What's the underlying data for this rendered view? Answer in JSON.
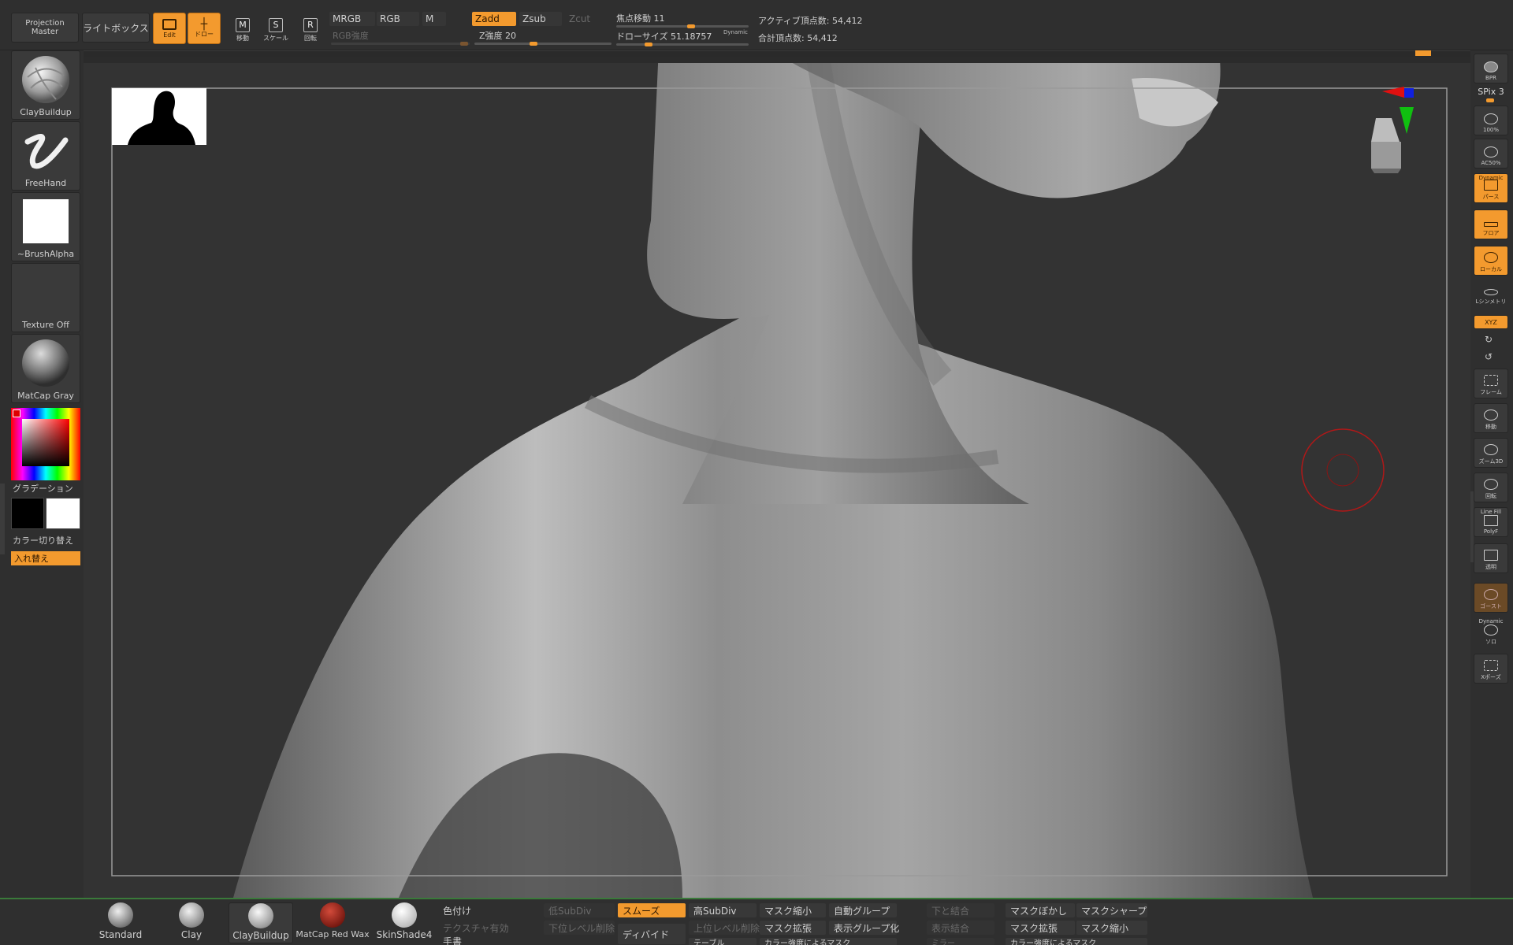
{
  "toolbar": {
    "projection_master": "Projection Master",
    "lightbox": "ライトボックス",
    "edit": "Edit",
    "draw": "ドロー",
    "move": "移動",
    "scale": "スケール",
    "rotate": "回転",
    "mrgb": "MRGB",
    "rgb": "RGB",
    "m": "M",
    "rgb_intensity": "RGB強度",
    "zadd": "Zadd",
    "zsub": "Zsub",
    "zcut": "Zcut",
    "z_intensity": "Z強度 20",
    "focal_shift": "焦点移動 11",
    "draw_size": "ドローサイズ 51.18757",
    "dynamic": "Dynamic",
    "active_points": "アクティブ頂点数: 54,412",
    "total_points": "合計頂点数: 54,412",
    "move_letter": "M",
    "scale_letter": "S",
    "rotate_letter": "R"
  },
  "left_shelf": {
    "brush": "ClayBuildup",
    "stroke": "FreeHand",
    "alpha": "~BrushAlpha",
    "texture": "Texture Off",
    "material": "MatCap Gray",
    "gradient": "グラデーション",
    "color_switch": "カラー切り替え",
    "swap": "入れ替え"
  },
  "right_shelf": {
    "bpr": "BPR",
    "spix": "SPix 3",
    "actual": "100%",
    "aahalf": "AC50%",
    "dynamic_label": "Dynamic",
    "persp": "パース",
    "floor": "フロア",
    "local": "ローカル",
    "sym": "Lシンメトリ",
    "xyz": "XYZ",
    "frame": "フレーム",
    "move": "移動",
    "zoom3d": "ズーム3D",
    "rotate": "回転",
    "linefill": "Line Fill",
    "polyf": "PolyF",
    "transp": "透明",
    "ghost": "ゴースト",
    "dynamic_label2": "Dynamic",
    "solo": "ソロ",
    "xpose": "Xポーズ"
  },
  "bottom_tray": {
    "materials": [
      "Standard",
      "Clay",
      "ClayBuildup",
      "MatCap Red Wax",
      "SkinShade4"
    ],
    "buttons_row1": [
      "色付け",
      "低SubDiv",
      "スムーズ",
      "高SubDiv",
      "マスク縮小",
      "自動グループ",
      "下と結合",
      "マスクぼかし",
      "マスクシャープ"
    ],
    "buttons_row2": [
      "テクスチャ有効",
      "下位レベル削除",
      "ディバイド",
      "上位レベル削除",
      "マスク拡張",
      "表示グループ化",
      "表示結合",
      "マスク拡張",
      "マスク縮小"
    ],
    "buttons_row3": [
      "手書",
      "テーブル",
      "カラー強度によるマスク",
      "ミラー",
      "カラー強度によるマスク"
    ]
  },
  "colors": {
    "accent": "#f39a2e",
    "canvas": "#333333",
    "panel": "#2f2f2f"
  }
}
